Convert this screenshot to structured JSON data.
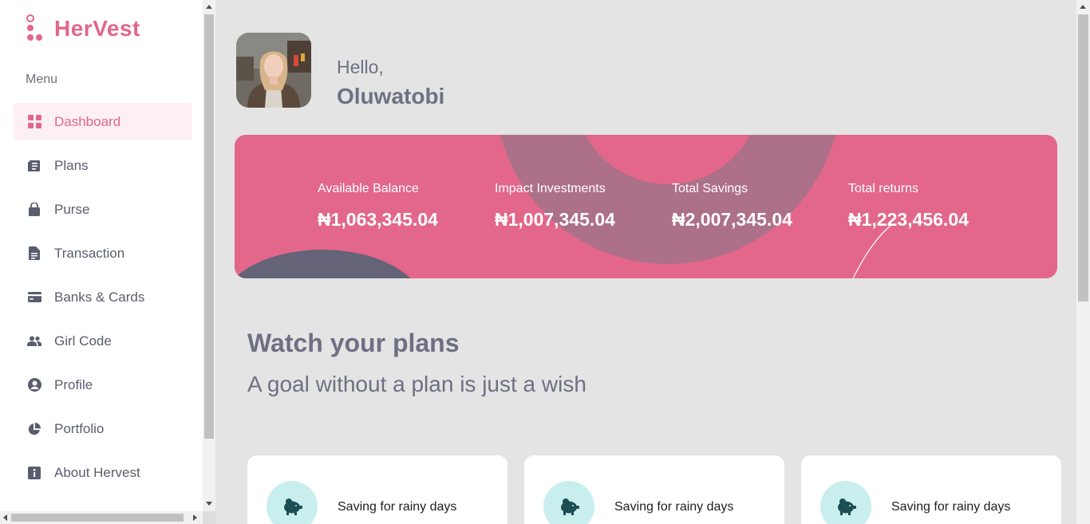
{
  "brand": {
    "name": "HerVest",
    "color": "#e2678a"
  },
  "sidebar": {
    "menu_label": "Menu",
    "items": [
      {
        "label": "Dashboard",
        "icon": "dashboard-icon",
        "active": true
      },
      {
        "label": "Plans",
        "icon": "plans-icon"
      },
      {
        "label": "Purse",
        "icon": "purse-icon"
      },
      {
        "label": "Transaction",
        "icon": "transaction-icon"
      },
      {
        "label": "Banks & Cards",
        "icon": "card-icon"
      },
      {
        "label": "Girl Code",
        "icon": "people-icon"
      },
      {
        "label": "Profile",
        "icon": "profile-icon"
      },
      {
        "label": "Portfolio",
        "icon": "pie-chart-icon"
      },
      {
        "label": "About Hervest",
        "icon": "info-icon"
      }
    ]
  },
  "header": {
    "greeting": "Hello,",
    "user_name": "Oluwatobi"
  },
  "summary": [
    {
      "label": "Available Balance",
      "value": "₦1,063,345.04"
    },
    {
      "label": "Impact Investments",
      "value": "₦1,007,345.04"
    },
    {
      "label": "Total Savings",
      "value": "₦2,007,345.04"
    },
    {
      "label": "Total returns",
      "value": "₦1,223,456.04"
    }
  ],
  "plans": {
    "title": "Watch your plans",
    "subtitle": "A goal without a plan is just a wish",
    "cards": [
      {
        "title": "Saving for rainy days",
        "icon": "piggy-bank-icon"
      },
      {
        "title": "Saving for rainy days",
        "icon": "piggy-bank-icon"
      },
      {
        "title": "Saving for rainy days",
        "icon": "piggy-bank-icon"
      }
    ]
  },
  "colors": {
    "accent": "#e2678a",
    "banner_circle": "#ad7089",
    "banner_dark": "#646378",
    "icon_circle": "#c9eeee",
    "icon_fg": "#1d4e54",
    "text_muted": "#6e7083"
  }
}
